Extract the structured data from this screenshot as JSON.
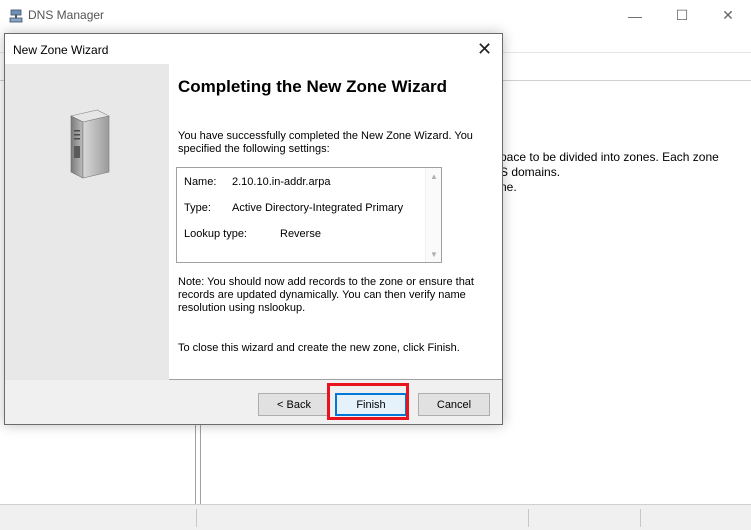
{
  "main_window": {
    "title": "DNS Manager",
    "controls": {
      "minimize": "—",
      "maximize": "☐",
      "close": "✕"
    },
    "background_text": [
      "pace to be divided into zones. Each zone",
      "S domains.",
      "",
      "ne."
    ]
  },
  "wizard": {
    "title": "New Zone Wizard",
    "close_glyph": "✕",
    "heading": "Completing the New Zone Wizard",
    "intro": "You have successfully completed the New Zone Wizard. You specified the following settings:",
    "settings": [
      {
        "label": "Name:",
        "value": "2.10.10.in-addr.arpa"
      },
      {
        "label": "Type:",
        "value": "Active Directory-Integrated Primary"
      },
      {
        "label": "Lookup type:",
        "value": "Reverse"
      }
    ],
    "note": "Note: You should now add records to the zone or ensure that records are updated dynamically. You can then verify name resolution using nslookup.",
    "close_note": "To close this wizard and create the new zone, click Finish.",
    "buttons": {
      "back": "< Back",
      "finish": "Finish",
      "cancel": "Cancel"
    }
  },
  "colors": {
    "highlight": "#e8131f",
    "focus": "#0078d7"
  },
  "icons": [
    "dns-manager-icon",
    "server-icon",
    "scroll-up-icon",
    "scroll-down-icon",
    "close-icon"
  ]
}
